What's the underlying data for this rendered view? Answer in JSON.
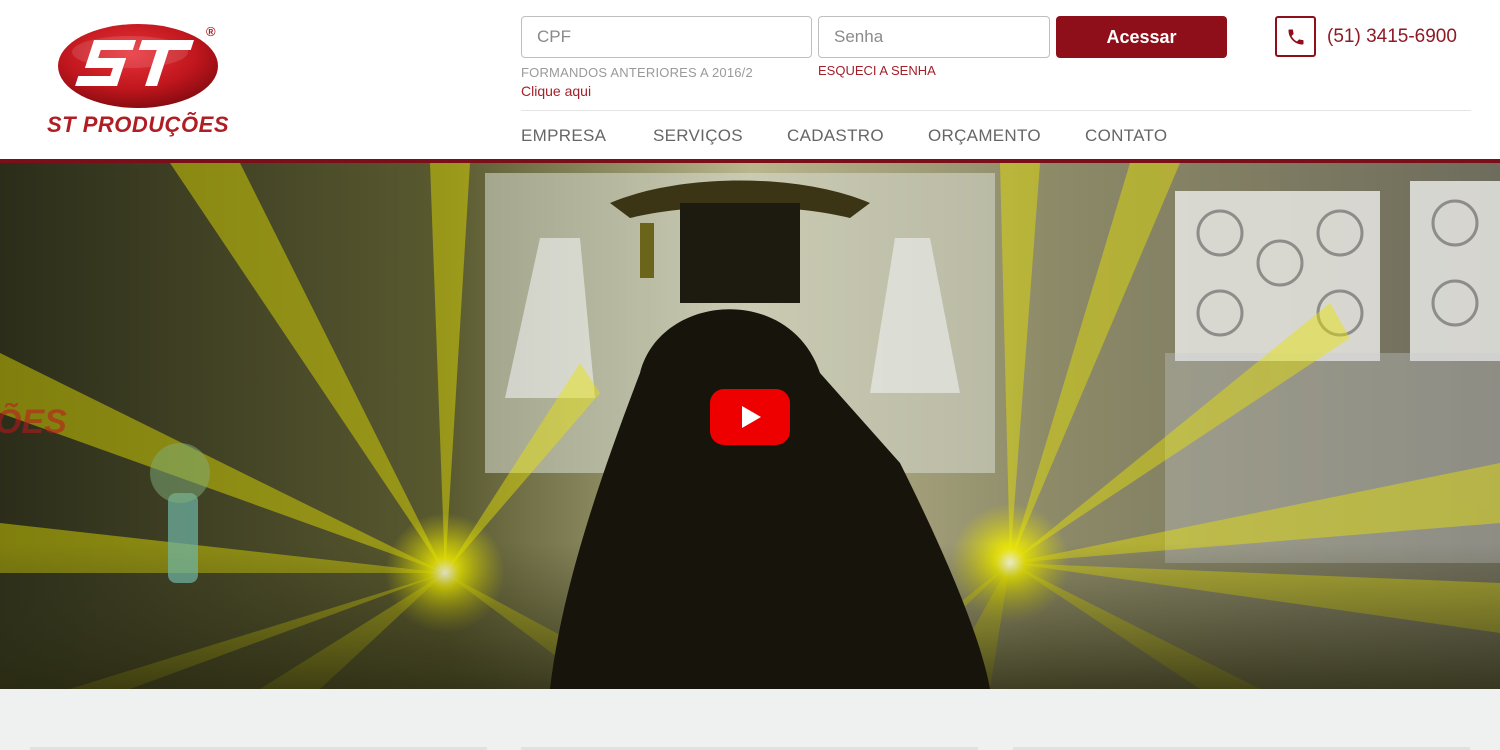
{
  "brand": {
    "logo_monogram": "ST",
    "name": "ST PRODUÇÕES",
    "registered_mark": "®"
  },
  "login": {
    "cpf_placeholder": "CPF",
    "senha_placeholder": "Senha",
    "submit_label": "Acessar",
    "former_students_note": "FORMANDOS ANTERIORES A 2016/2",
    "former_students_link": "Clique aqui",
    "forgot_password": "ESQUECI A SENHA"
  },
  "contact": {
    "phone_icon": "phone-icon",
    "phone": "(51) 3415-6900"
  },
  "nav": {
    "items": [
      {
        "label": "EMPRESA"
      },
      {
        "label": "SERVIÇOS"
      },
      {
        "label": "CADASTRO"
      },
      {
        "label": "ORÇAMENTO"
      },
      {
        "label": "CONTATO"
      }
    ]
  },
  "video": {
    "play_icon": "youtube-play-icon"
  },
  "colors": {
    "brand_red": "#8e0f19",
    "logo_red": "#b01e24",
    "youtube_red": "#ee0000"
  }
}
